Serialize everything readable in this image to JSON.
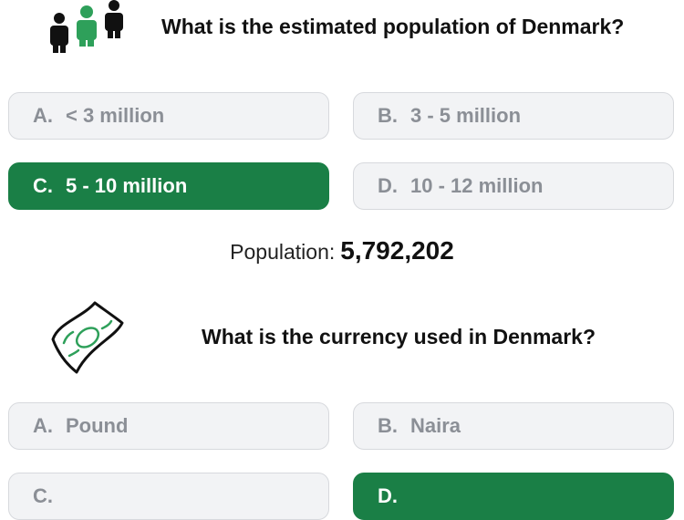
{
  "quiz1": {
    "question": "What is the estimated population of Denmark?",
    "icon": "people-icon",
    "options": [
      {
        "letter": "A.",
        "text": "< 3 million"
      },
      {
        "letter": "B.",
        "text": "3 - 5 million"
      },
      {
        "letter": "C.",
        "text": "5 - 10 million"
      },
      {
        "letter": "D.",
        "text": "10 - 12 million"
      }
    ],
    "selected": "C.",
    "answer_label": "Population:",
    "answer_value": "5,792,202"
  },
  "quiz2": {
    "question": "What is the currency used in Denmark?",
    "icon": "banknote-icon",
    "options": [
      {
        "letter": "A.",
        "text": "Pound"
      },
      {
        "letter": "B.",
        "text": "Naira"
      },
      {
        "letter": "C.",
        "text": ""
      },
      {
        "letter": "D.",
        "text": ""
      }
    ],
    "selected": "D."
  },
  "colors": {
    "selected": "#1a7f46",
    "option_bg": "#f2f3f5",
    "option_text": "#8b8f96",
    "accent_icon": "#2ea05a"
  }
}
